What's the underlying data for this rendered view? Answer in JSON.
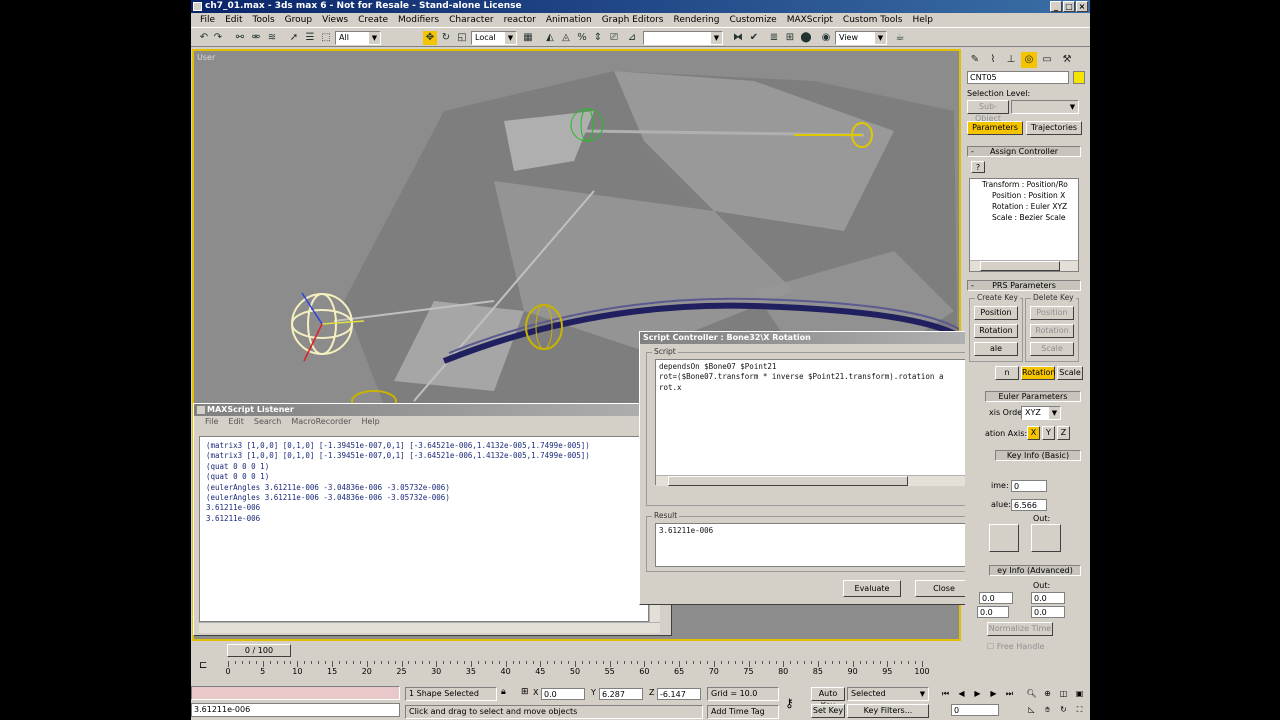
{
  "window": {
    "title": "ch7_01.max - 3ds max 6 - Not for Resale - Stand-alone License"
  },
  "menu": [
    "File",
    "Edit",
    "Tools",
    "Group",
    "Views",
    "Create",
    "Modifiers",
    "Character",
    "reactor",
    "Animation",
    "Graph Editors",
    "Rendering",
    "Customize",
    "MAXScript",
    "Custom Tools",
    "Help"
  ],
  "toolbar": {
    "filter": "All",
    "coord": "Local",
    "view": "View"
  },
  "viewport": {
    "label": "User"
  },
  "panel": {
    "object_name": "CNT05",
    "object_color": "#f5e400",
    "selection_level_label": "Selection Level:",
    "subobject": "Sub-Object",
    "tabs": [
      "Parameters",
      "Trajectories"
    ],
    "assign_controller": "Assign Controller",
    "tree": [
      "Transform : Position/Ro",
      "Position : Position X",
      "Rotation : Euler XYZ",
      "Scale : Bezier Scale"
    ],
    "prs_title": "PRS Parameters",
    "create_key": "Create Key",
    "delete_key": "Delete Key",
    "keys": [
      "Position",
      "Rotation",
      "Scale"
    ],
    "key_partial": [
      "Rotation",
      "ale",
      "n"
    ],
    "euler_title": "Euler Parameters",
    "axis_order_label": "xis Order:",
    "axis_order": "XYZ",
    "axis_label": "ation Axis:",
    "axes": [
      "X",
      "Y",
      "Z"
    ],
    "keyinfo_basic": "Key Info (Basic)",
    "time_label": "ime:",
    "time_value": "0",
    "value_label": "alue:",
    "value_value": "6.566",
    "out_label": "Out:",
    "keyinfo_adv": "ey Info (Advanced)",
    "out2_label": "Out:",
    "adv_values": [
      "0.0",
      "0.0",
      "0.0",
      "0.0"
    ],
    "normalize": "Normalize Time",
    "free_handle": "Free Handle"
  },
  "listener": {
    "title": "MAXScript Listener",
    "menu": [
      "File",
      "Edit",
      "Search",
      "MacroRecorder",
      "Help"
    ],
    "lines": [
      "(matrix3 [1,0,0] [0,1,0] [-1.39451e-007,0,1] [-3.64521e-006,1.4132e-005,1.7499e-005])",
      "(matrix3 [1,0,0] [0,1,0] [-1.39451e-007,0,1] [-3.64521e-006,1.4132e-005,1.7499e-005])",
      "(quat 0 0 0 1)",
      "(quat 0 0 0 1)",
      "(eulerAngles 3.61211e-006 -3.04836e-006 -3.05732e-006)",
      "(eulerAngles 3.61211e-006 -3.04836e-006 -3.05732e-006)",
      "3.61211e-006",
      "3.61211e-006"
    ]
  },
  "script_dialog": {
    "title": "Script Controller : Bone32\\X Rotation",
    "script_label": "Script",
    "script_lines": [
      "dependsOn $Bone07 $Point21",
      "",
      "rot=($Bone07.transform * inverse $Point21.transform).rotation a",
      "rot.x"
    ],
    "result_label": "Result",
    "result": "3.61211e-006",
    "evaluate": "Evaluate",
    "close": "Close"
  },
  "timeline": {
    "slider": "0 / 100",
    "ticks": [
      "0",
      "5",
      "10",
      "15",
      "20",
      "25",
      "30",
      "35",
      "40",
      "45",
      "50",
      "55",
      "60",
      "65",
      "70",
      "75",
      "80",
      "85",
      "90",
      "95",
      "100"
    ]
  },
  "status": {
    "maxscript_result": "3.61211e-006",
    "selection": "1 Shape Selected",
    "prompt": "Click and drag to select and move objects",
    "x_label": "X",
    "x": "0.0",
    "y_label": "Y",
    "y": "6.287",
    "z_label": "Z",
    "z": "-6.147",
    "grid": "Grid = 10.0",
    "add_time_tag": "Add Time Tag",
    "auto_key": "Auto Key",
    "set_key": "Set Key",
    "selected": "Selected",
    "key_filters": "Key Filters...",
    "frame": "0"
  }
}
